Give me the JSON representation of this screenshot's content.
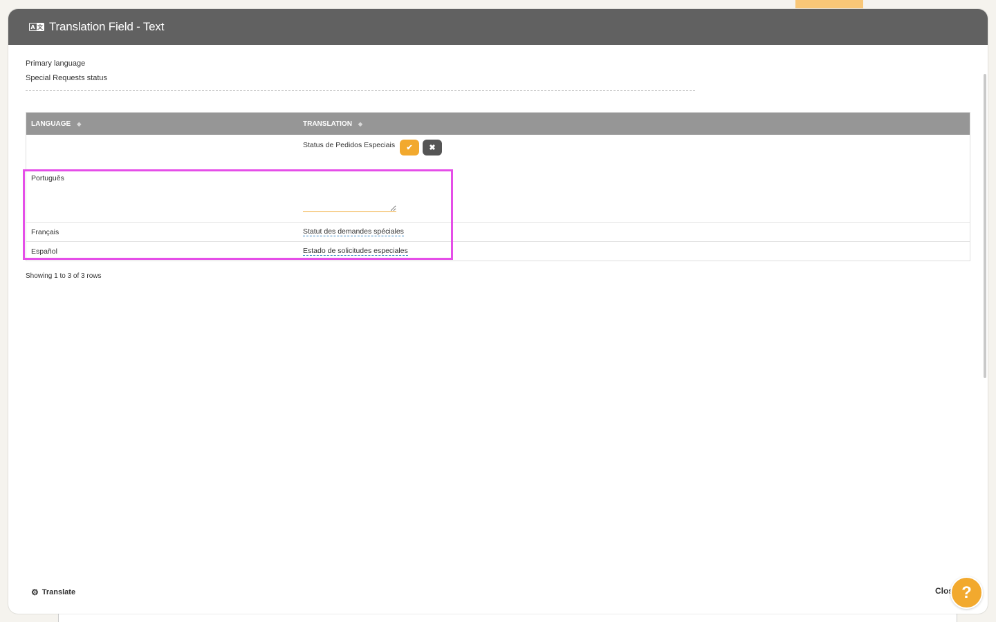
{
  "header": {
    "title": "Translation Field - Text",
    "icon": "translate-badge-icon"
  },
  "primary": {
    "label": "Primary language",
    "value": "Special Requests status"
  },
  "table": {
    "columns": [
      "LANGUAGE",
      "TRANSLATION"
    ],
    "rows": [
      {
        "language": "Português",
        "translation": "Status de Pedidos Especiais",
        "editing": true
      },
      {
        "language": "Français",
        "translation": "Statut des demandes spéciales"
      },
      {
        "language": "Español",
        "translation": "Estado de solicitudes especiales"
      }
    ],
    "pagination": "Showing 1 to 3 of 3 rows"
  },
  "editor": {
    "confirm_icon": "check-icon",
    "cancel_icon": "x-icon"
  },
  "footer": {
    "translate_label": "Translate",
    "close_label": "Clos"
  },
  "help": {
    "label": "?"
  },
  "colors": {
    "header_bg": "#616161",
    "accent": "#f2a92e",
    "table_header_bg": "#969696",
    "highlight": "#e54ee8"
  }
}
